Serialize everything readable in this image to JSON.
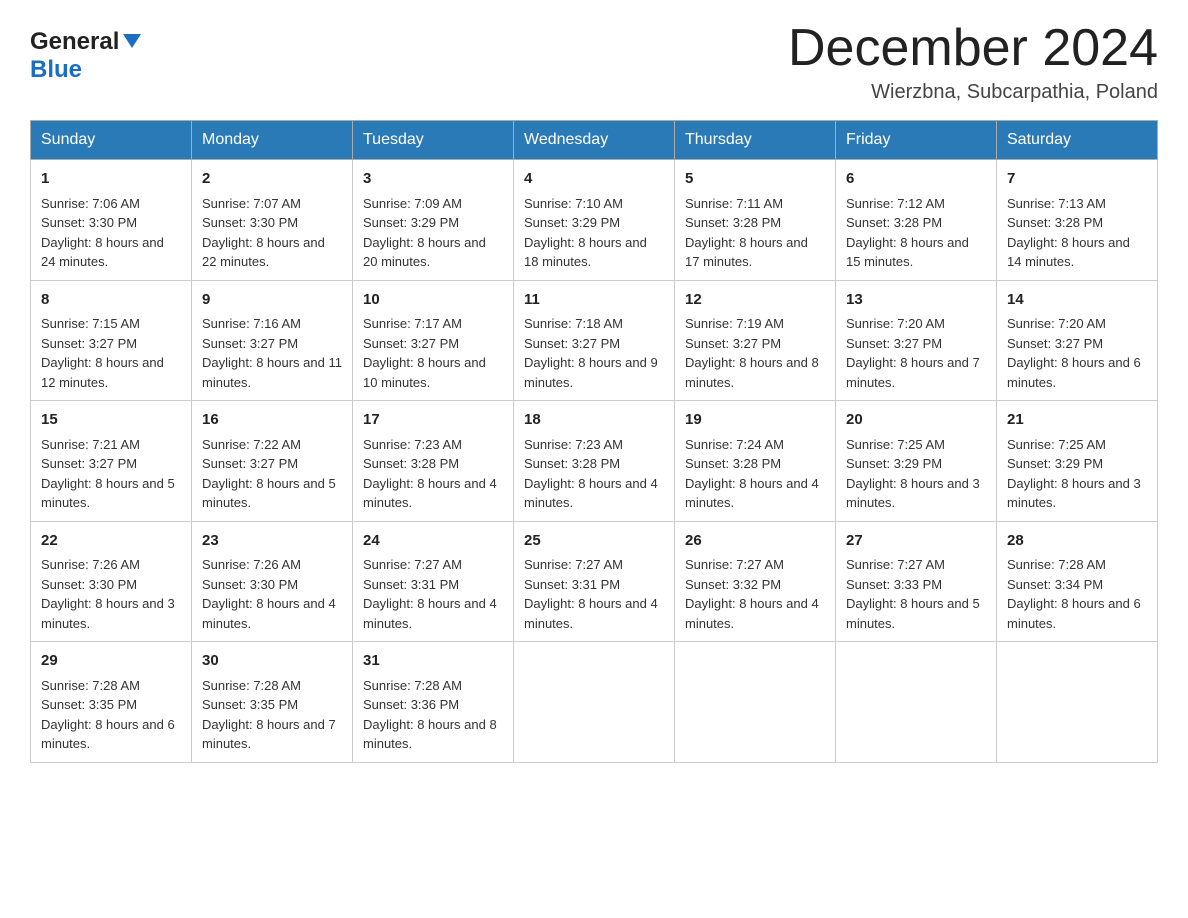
{
  "header": {
    "logo_general": "General",
    "logo_blue": "Blue",
    "month_title": "December 2024",
    "location": "Wierzbna, Subcarpathia, Poland"
  },
  "days_of_week": [
    "Sunday",
    "Monday",
    "Tuesday",
    "Wednesday",
    "Thursday",
    "Friday",
    "Saturday"
  ],
  "weeks": [
    [
      {
        "day": "1",
        "sunrise": "Sunrise: 7:06 AM",
        "sunset": "Sunset: 3:30 PM",
        "daylight": "Daylight: 8 hours and 24 minutes."
      },
      {
        "day": "2",
        "sunrise": "Sunrise: 7:07 AM",
        "sunset": "Sunset: 3:30 PM",
        "daylight": "Daylight: 8 hours and 22 minutes."
      },
      {
        "day": "3",
        "sunrise": "Sunrise: 7:09 AM",
        "sunset": "Sunset: 3:29 PM",
        "daylight": "Daylight: 8 hours and 20 minutes."
      },
      {
        "day": "4",
        "sunrise": "Sunrise: 7:10 AM",
        "sunset": "Sunset: 3:29 PM",
        "daylight": "Daylight: 8 hours and 18 minutes."
      },
      {
        "day": "5",
        "sunrise": "Sunrise: 7:11 AM",
        "sunset": "Sunset: 3:28 PM",
        "daylight": "Daylight: 8 hours and 17 minutes."
      },
      {
        "day": "6",
        "sunrise": "Sunrise: 7:12 AM",
        "sunset": "Sunset: 3:28 PM",
        "daylight": "Daylight: 8 hours and 15 minutes."
      },
      {
        "day": "7",
        "sunrise": "Sunrise: 7:13 AM",
        "sunset": "Sunset: 3:28 PM",
        "daylight": "Daylight: 8 hours and 14 minutes."
      }
    ],
    [
      {
        "day": "8",
        "sunrise": "Sunrise: 7:15 AM",
        "sunset": "Sunset: 3:27 PM",
        "daylight": "Daylight: 8 hours and 12 minutes."
      },
      {
        "day": "9",
        "sunrise": "Sunrise: 7:16 AM",
        "sunset": "Sunset: 3:27 PM",
        "daylight": "Daylight: 8 hours and 11 minutes."
      },
      {
        "day": "10",
        "sunrise": "Sunrise: 7:17 AM",
        "sunset": "Sunset: 3:27 PM",
        "daylight": "Daylight: 8 hours and 10 minutes."
      },
      {
        "day": "11",
        "sunrise": "Sunrise: 7:18 AM",
        "sunset": "Sunset: 3:27 PM",
        "daylight": "Daylight: 8 hours and 9 minutes."
      },
      {
        "day": "12",
        "sunrise": "Sunrise: 7:19 AM",
        "sunset": "Sunset: 3:27 PM",
        "daylight": "Daylight: 8 hours and 8 minutes."
      },
      {
        "day": "13",
        "sunrise": "Sunrise: 7:20 AM",
        "sunset": "Sunset: 3:27 PM",
        "daylight": "Daylight: 8 hours and 7 minutes."
      },
      {
        "day": "14",
        "sunrise": "Sunrise: 7:20 AM",
        "sunset": "Sunset: 3:27 PM",
        "daylight": "Daylight: 8 hours and 6 minutes."
      }
    ],
    [
      {
        "day": "15",
        "sunrise": "Sunrise: 7:21 AM",
        "sunset": "Sunset: 3:27 PM",
        "daylight": "Daylight: 8 hours and 5 minutes."
      },
      {
        "day": "16",
        "sunrise": "Sunrise: 7:22 AM",
        "sunset": "Sunset: 3:27 PM",
        "daylight": "Daylight: 8 hours and 5 minutes."
      },
      {
        "day": "17",
        "sunrise": "Sunrise: 7:23 AM",
        "sunset": "Sunset: 3:28 PM",
        "daylight": "Daylight: 8 hours and 4 minutes."
      },
      {
        "day": "18",
        "sunrise": "Sunrise: 7:23 AM",
        "sunset": "Sunset: 3:28 PM",
        "daylight": "Daylight: 8 hours and 4 minutes."
      },
      {
        "day": "19",
        "sunrise": "Sunrise: 7:24 AM",
        "sunset": "Sunset: 3:28 PM",
        "daylight": "Daylight: 8 hours and 4 minutes."
      },
      {
        "day": "20",
        "sunrise": "Sunrise: 7:25 AM",
        "sunset": "Sunset: 3:29 PM",
        "daylight": "Daylight: 8 hours and 3 minutes."
      },
      {
        "day": "21",
        "sunrise": "Sunrise: 7:25 AM",
        "sunset": "Sunset: 3:29 PM",
        "daylight": "Daylight: 8 hours and 3 minutes."
      }
    ],
    [
      {
        "day": "22",
        "sunrise": "Sunrise: 7:26 AM",
        "sunset": "Sunset: 3:30 PM",
        "daylight": "Daylight: 8 hours and 3 minutes."
      },
      {
        "day": "23",
        "sunrise": "Sunrise: 7:26 AM",
        "sunset": "Sunset: 3:30 PM",
        "daylight": "Daylight: 8 hours and 4 minutes."
      },
      {
        "day": "24",
        "sunrise": "Sunrise: 7:27 AM",
        "sunset": "Sunset: 3:31 PM",
        "daylight": "Daylight: 8 hours and 4 minutes."
      },
      {
        "day": "25",
        "sunrise": "Sunrise: 7:27 AM",
        "sunset": "Sunset: 3:31 PM",
        "daylight": "Daylight: 8 hours and 4 minutes."
      },
      {
        "day": "26",
        "sunrise": "Sunrise: 7:27 AM",
        "sunset": "Sunset: 3:32 PM",
        "daylight": "Daylight: 8 hours and 4 minutes."
      },
      {
        "day": "27",
        "sunrise": "Sunrise: 7:27 AM",
        "sunset": "Sunset: 3:33 PM",
        "daylight": "Daylight: 8 hours and 5 minutes."
      },
      {
        "day": "28",
        "sunrise": "Sunrise: 7:28 AM",
        "sunset": "Sunset: 3:34 PM",
        "daylight": "Daylight: 8 hours and 6 minutes."
      }
    ],
    [
      {
        "day": "29",
        "sunrise": "Sunrise: 7:28 AM",
        "sunset": "Sunset: 3:35 PM",
        "daylight": "Daylight: 8 hours and 6 minutes."
      },
      {
        "day": "30",
        "sunrise": "Sunrise: 7:28 AM",
        "sunset": "Sunset: 3:35 PM",
        "daylight": "Daylight: 8 hours and 7 minutes."
      },
      {
        "day": "31",
        "sunrise": "Sunrise: 7:28 AM",
        "sunset": "Sunset: 3:36 PM",
        "daylight": "Daylight: 8 hours and 8 minutes."
      },
      null,
      null,
      null,
      null
    ]
  ]
}
